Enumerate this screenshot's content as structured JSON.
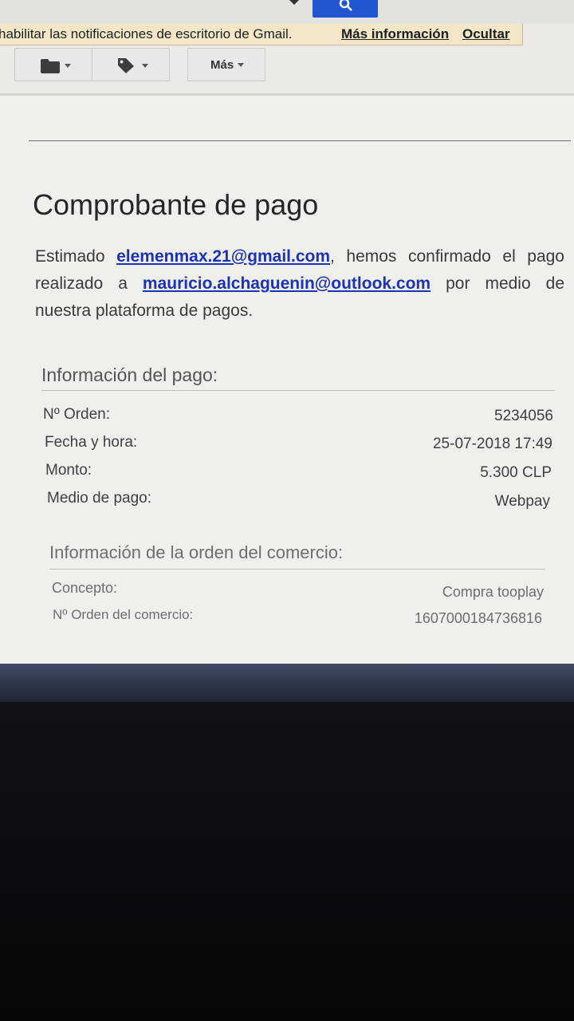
{
  "gmail": {
    "notification": {
      "text": "habilitar las notificaciones de escritorio de Gmail.",
      "more_link": "Más información",
      "hide_link": "Ocultar"
    },
    "toolbar": {
      "more_label": "Más"
    }
  },
  "email": {
    "title": "Comprobante de pago",
    "intro": {
      "greeting": "Estimado",
      "sender": "elemenmax.21@gmail.com",
      "mid": ", hemos confirmado el pago realizado a",
      "recipient": "mauricio.alchaguenin@outlook.com",
      "end": "por medio de nuestra plataforma de pagos."
    },
    "payment_info": {
      "title": "Información del pago:",
      "rows": [
        {
          "label": "Nº Orden:",
          "value": "5234056"
        },
        {
          "label": "Fecha y hora:",
          "value": "25-07-2018 17:49"
        },
        {
          "label": "Monto:",
          "value": "5.300 CLP"
        },
        {
          "label": "Medio de pago:",
          "value": "Webpay"
        }
      ]
    },
    "merchant_info": {
      "title": "Información de la orden del comercio:",
      "rows": [
        {
          "label": "Concepto:",
          "value": "Compra tooplay"
        },
        {
          "label": "Nº Orden del comercio:",
          "value": "1607000184736816"
        }
      ]
    }
  }
}
